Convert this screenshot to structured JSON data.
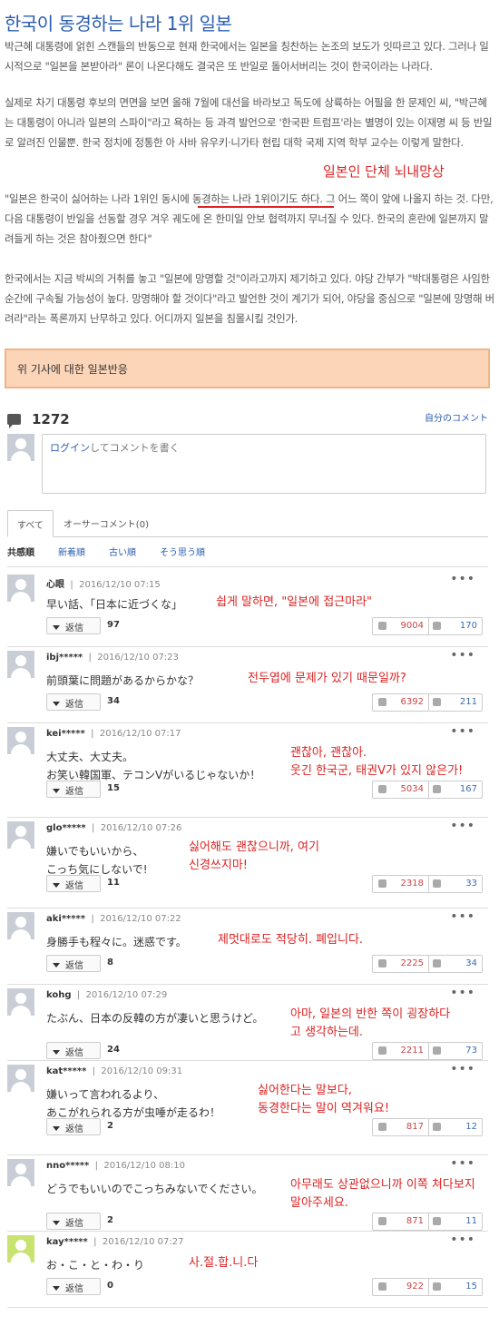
{
  "article": {
    "title": "한국이 동경하는 나라 1위 일본",
    "p1": "박근혜 대통령에 얽힌 스캔들의 반동으로 현재 한국에서는 일본을 칭찬하는 논조의 보도가 잇따르고 있다. 그러나 일시적으로 \"일본을 본받아라\" 론이 나온다해도 결국은 또 반일로 돌아서버리는 것이 한국이라는 나라다.",
    "p2": "실제로 차기 대통령 후보의 면면을 보면 올해 7월에 대선을 바라보고 독도에 상륙하는 어필을 한 문제인 씨, \"박근혜는 대통령이 아니라 일본의 스파이\"라고 욕하는 등 과격 발언으로 '한국판 트럼프'라는 별명이 있는 이재명 씨 등 반일로 알려진 인물뿐. 한국 정치에 정통한 아 사바 유우키·니가타 현립 대학 국제 지역 학부 교수는 이렇게 말한다.",
    "p3": "\"일본은 한국이 싫어하는 나라 1위인 동시에 동경하는 나라 1위이기도 하다. 그 어느 쪽이 앞에 나올지 하는 것. 다만, 다음 대통령이 반일을 선동할 경우 겨우 궤도에 온 한미일 안보 협력까지 무너질 수 있다. 한국의 혼란에 일본까지 말려들게 하는 것은 참아줬으면 한다\"",
    "p4": "한국에서는 지금 박씨의 거취를 놓고 \"일본에 망명할 것\"이라고까지 제기하고 있다. 야당 간부가 \"박대통령은 사임한 순간에 구속될 가능성이 높다. 망명해야 할 것이다\"라고 발언한 것이 계기가 되어, 야당을 중심으로 \"일본에 망명해 버려라\"라는 폭론까지 난무하고 있다. 어디까지 일본을 침몰시킬 것인가.",
    "annotation": "일본인 단체 뇌내망상",
    "banner": "위 기사에 대한 일본반응"
  },
  "comments_header": {
    "count": "1272",
    "my_comments": "自分のコメント",
    "login_link": "ログイン",
    "login_text": "してコメントを書く"
  },
  "tabs": [
    "すべて",
    "オーサーコメント(0)"
  ],
  "sorts": [
    "共感順",
    "新着順",
    "古い順",
    "そう思う順"
  ],
  "reply_label": "返信",
  "more_label": "•••",
  "comments": [
    {
      "user": "心眼",
      "date": "2016/12/10 07:15",
      "text": "早い話、「日本に近づくな」",
      "kor": "쉽게 말하면, \"일본에 접근마라\"",
      "replies": "97",
      "up": "9004",
      "down": "170"
    },
    {
      "user": "ibj*****",
      "date": "2016/12/10 07:23",
      "text": "前頭葉に問題があるからかな？",
      "kor": "전두엽에 문제가 있기 때문일까?",
      "replies": "34",
      "up": "6392",
      "down": "211"
    },
    {
      "user": "kei*****",
      "date": "2016/12/10 07:17",
      "text": "大丈夫、大丈夫。\nお笑い韓国軍、テコンVがいるじゃないか！",
      "kor": "괜찮아, 괜찮아.\n웃긴 한국군, 태권V가 있지 않은가!",
      "replies": "15",
      "up": "5034",
      "down": "167"
    },
    {
      "user": "glo*****",
      "date": "2016/12/10 07:26",
      "text": "嫌いでもいいから、\nこっち気にしないで!",
      "kor": "싫어해도 괜찮으니까, 여기\n신경쓰지마!",
      "replies": "11",
      "up": "2318",
      "down": "33"
    },
    {
      "user": "aki*****",
      "date": "2016/12/10 07:22",
      "text": "身勝手も程々に。迷惑です。",
      "kor": "제멋대로도 적당히. 폐입니다.",
      "replies": "8",
      "up": "2225",
      "down": "34"
    },
    {
      "user": "kohg",
      "date": "2016/12/10 07:29",
      "text": "たぶん、日本の反韓の方が凄いと思うけど。",
      "kor": "아마, 일본의 반한 쪽이 굉장하다\n고 생각하는데.",
      "replies": "24",
      "up": "2211",
      "down": "73"
    },
    {
      "user": "kat*****",
      "date": "2016/12/10 09:31",
      "text": "嫌いって言われるより、\nあこがれられる方が虫唾が走るわ！",
      "kor": "싫어한다는 말보다,\n동경한다는 말이 역겨워요!",
      "replies": "2",
      "up": "817",
      "down": "12"
    },
    {
      "user": "nno*****",
      "date": "2016/12/10 08:10",
      "text": "どうでもいいのでこっちみないでください。",
      "kor": "아무래도 상관없으니까 이쪽 쳐다보지\n말아주세요.",
      "replies": "2",
      "up": "871",
      "down": "11"
    },
    {
      "user": "kay*****",
      "date": "2016/12/10 07:27",
      "text": "お・こ・と・わ・り",
      "kor": "사.절.합.니.다",
      "replies": "0",
      "up": "922",
      "down": "15"
    }
  ],
  "colors": {
    "title": "#2a5db0",
    "annotation": "#dd2222",
    "banner_bg": "#fcd5b8",
    "link": "#2a5db0"
  }
}
